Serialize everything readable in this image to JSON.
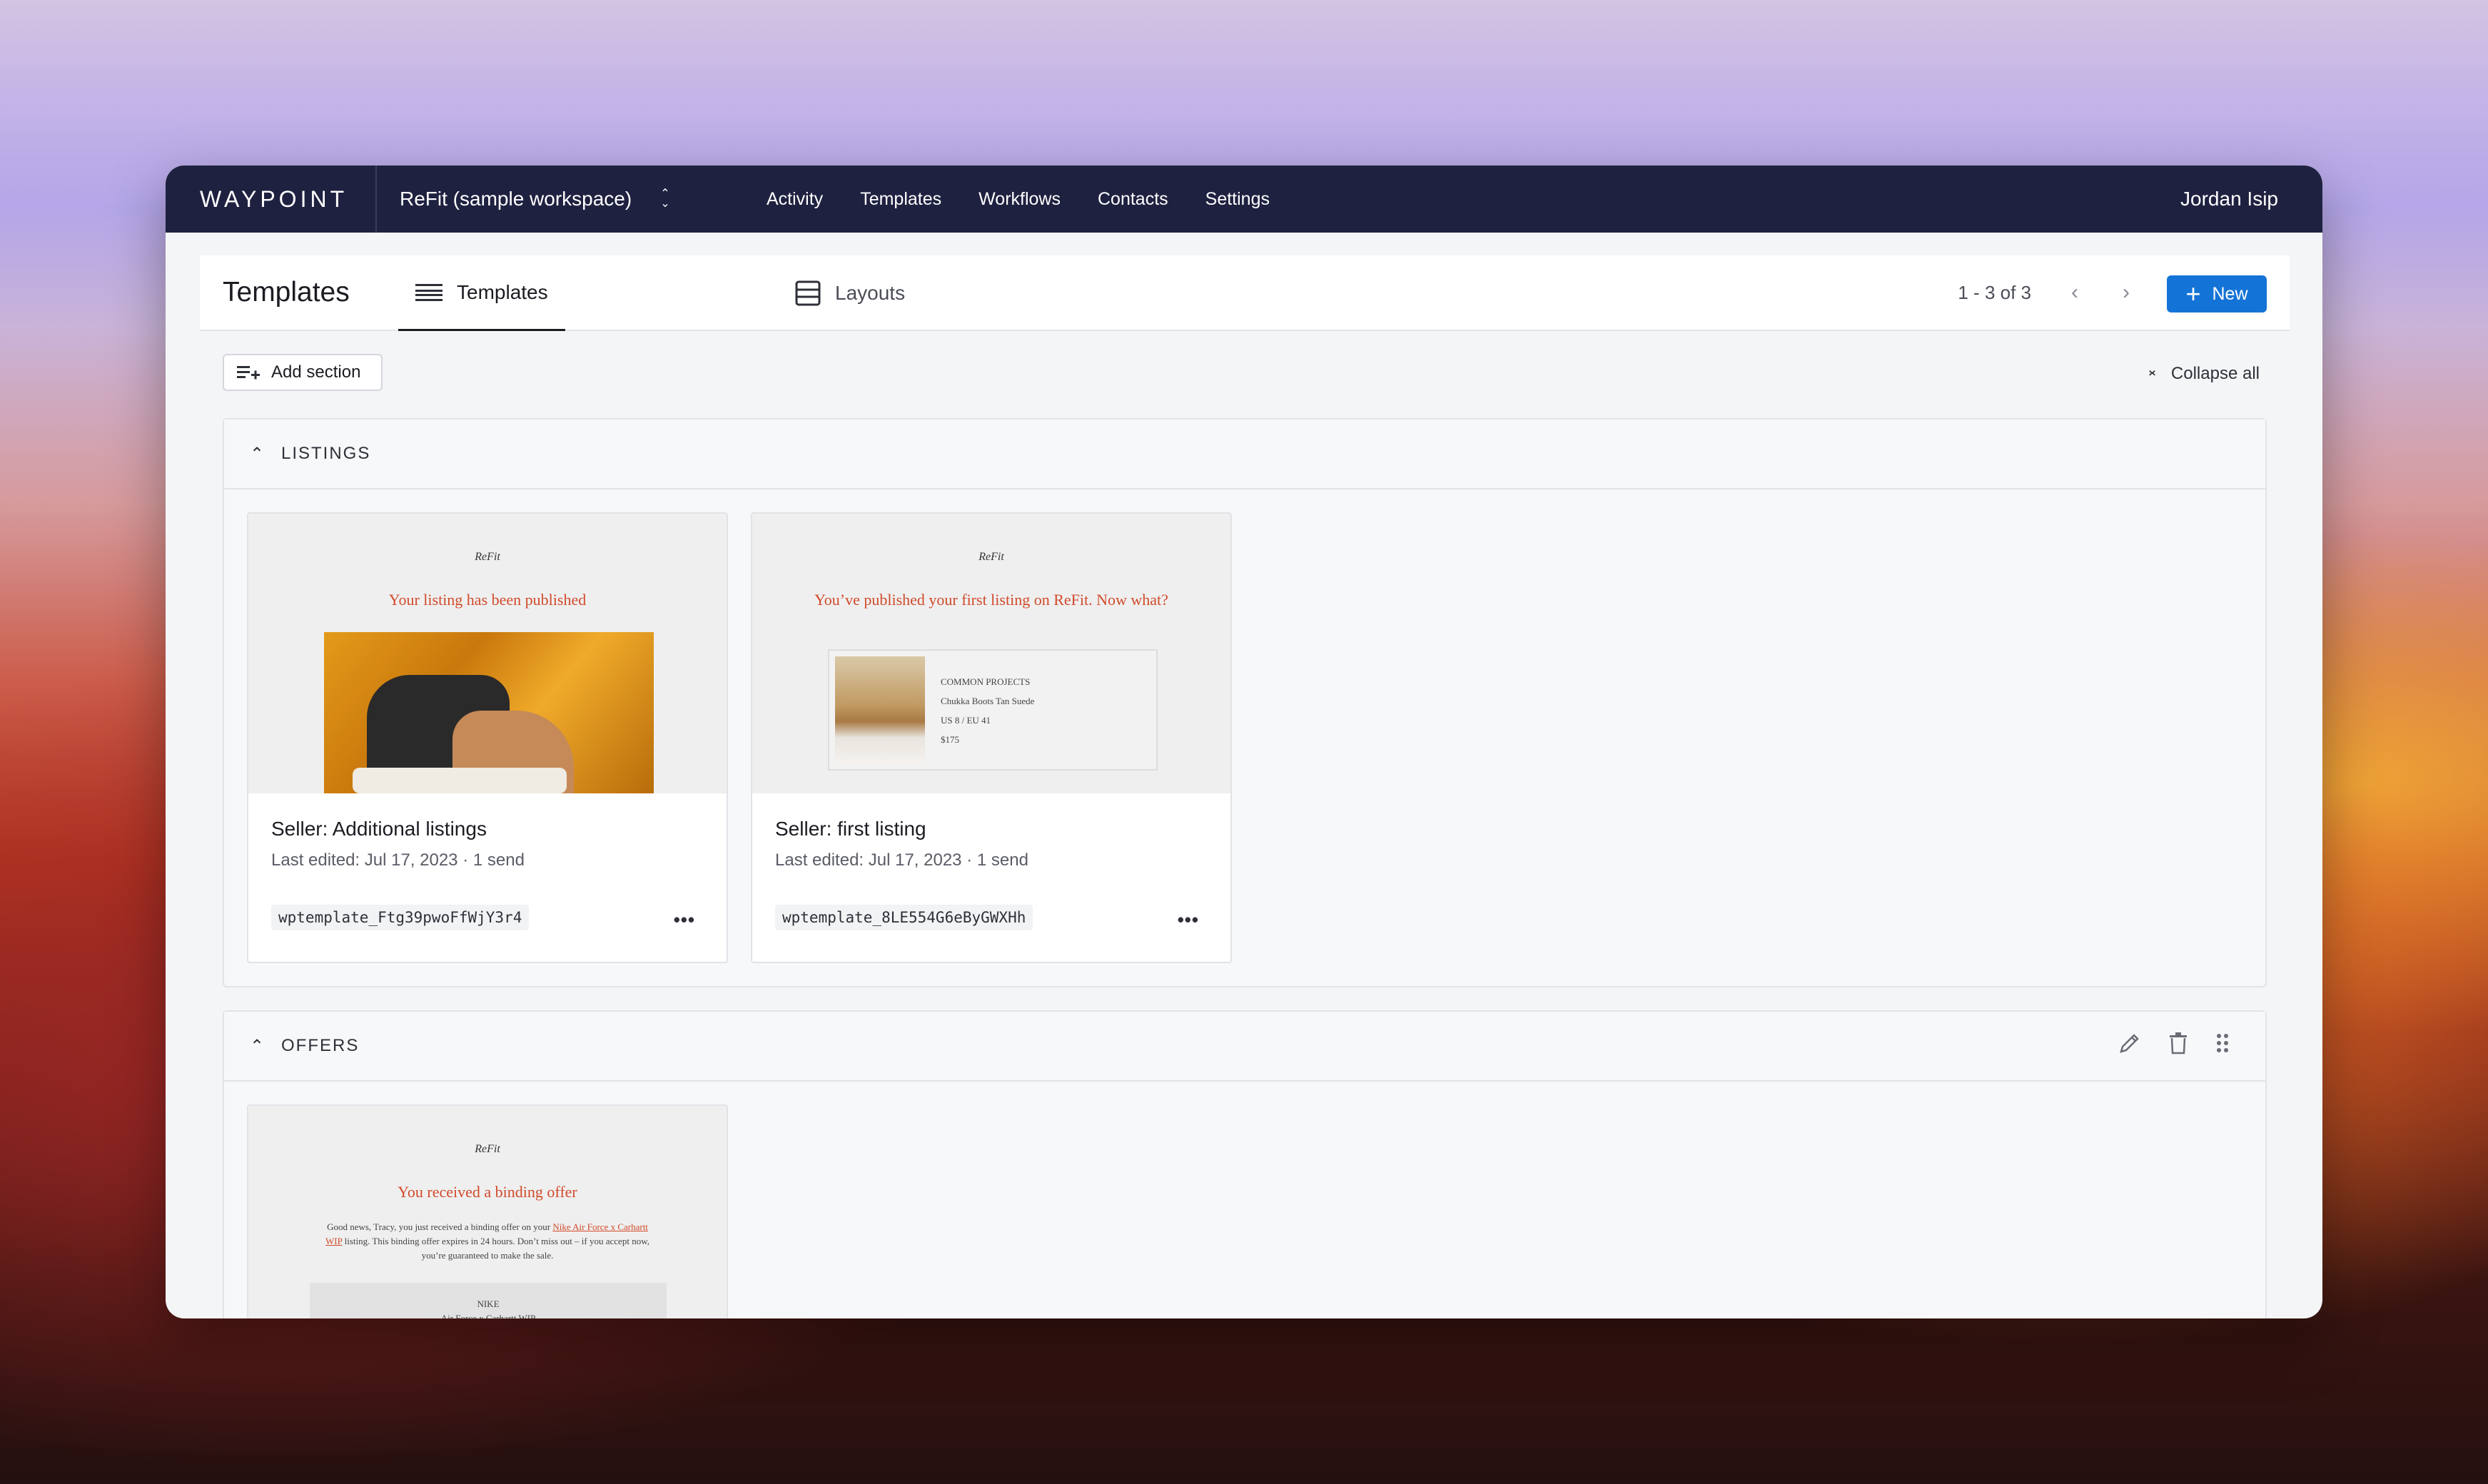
{
  "app": {
    "logo": "WAYPOINT",
    "workspace": "ReFit (sample workspace)",
    "nav": [
      "Activity",
      "Templates",
      "Workflows",
      "Contacts",
      "Settings"
    ],
    "user": "Jordan Isip"
  },
  "header": {
    "title": "Templates",
    "tabs": [
      {
        "label": "Templates",
        "icon": "list-icon",
        "active": true
      },
      {
        "label": "Layouts",
        "icon": "layout-icon",
        "active": false
      }
    ],
    "pagination": "1 - 3 of 3",
    "new_label": "New"
  },
  "toolbar": {
    "add_section": "Add section",
    "collapse_all": "Collapse all"
  },
  "sections": [
    {
      "label": "LISTINGS",
      "cards": [
        {
          "title": "Seller: Additional listings",
          "meta": "Last edited: Jul 17, 2023  ·   1 send",
          "id": "wptemplate_Ftg39pwoFfWjY3r4",
          "preview": {
            "logo": "ReFit",
            "heading": "Your listing has been published"
          }
        },
        {
          "title": "Seller: first listing",
          "meta": "Last edited: Jul 17, 2023  ·   1 send",
          "id": "wptemplate_8LE554G6eByGWXHh",
          "preview": {
            "logo": "ReFit",
            "heading": "You’ve published your first listing on ReFit. Now what?",
            "product": [
              "COMMON PROJECTS",
              "Chukka Boots Tan Suede",
              "US 8 / EU 41",
              "$175"
            ]
          }
        }
      ]
    },
    {
      "label": "OFFERS",
      "cards": [
        {
          "preview": {
            "logo": "ReFit",
            "heading": "You received a binding offer",
            "body_start": "Good news, Tracy, you just received a binding offer on your ",
            "body_link": "Nike Air Force x Carhartt WIP",
            "body_end": " listing. This binding offer expires in 24 hours. Don’t miss out – if you accept now, you’re guaranteed to make the sale.",
            "brand": "NIKE",
            "product": "Air Force x Carhartt WIP"
          }
        }
      ]
    }
  ],
  "colors": {
    "topbar": "#1f2140",
    "primary": "#1473d6",
    "preview_accent": "#d14a2a"
  }
}
